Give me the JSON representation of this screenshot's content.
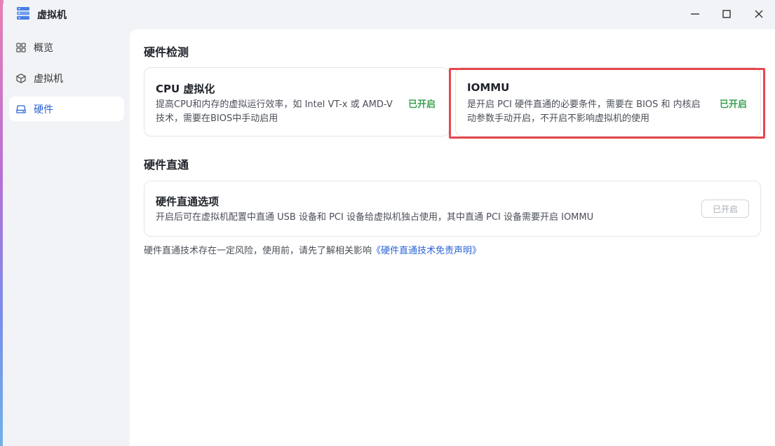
{
  "window": {
    "title": "虚拟机",
    "app_icon": "server-stack-icon",
    "controls": {
      "minimize": "minimize-icon",
      "maximize": "maximize-icon",
      "close": "close-icon"
    }
  },
  "sidebar": {
    "items": [
      {
        "label": "概览",
        "icon": "grid-icon",
        "active": false
      },
      {
        "label": "虚拟机",
        "icon": "cube-icon",
        "active": false
      },
      {
        "label": "硬件",
        "icon": "drive-icon",
        "active": true
      }
    ]
  },
  "main": {
    "detection": {
      "section_title": "硬件检测",
      "cpu": {
        "title": "CPU 虚拟化",
        "desc_line1": "提高CPU和内存的虚拟运行效率，如 Intel VT-x 或 AMD-V",
        "desc_line2": "技术，需要在BIOS中手动启用",
        "status": "已开启"
      },
      "iommu": {
        "title": "IOMMU",
        "desc_line1": "是开启 PCI 硬件直通的必要条件，需要在 BIOS 和 内核启",
        "desc_line2": "动参数手动开启，不开启不影响虚拟机的使用",
        "status": "已开启"
      }
    },
    "passthrough": {
      "section_title": "硬件直通",
      "option": {
        "title": "硬件直通选项",
        "desc": "开启后可在虚拟机配置中直通 USB 设备和 PCI 设备给虚拟机独占使用，其中直通 PCI 设备需要开启 IOMMU",
        "button": "已开启"
      },
      "note_text": "硬件直通技术存在一定风险，使用前，请先了解相关影响",
      "note_link": "《硬件直通技术免责声明》"
    }
  },
  "colors": {
    "accent": "#2a63d6",
    "status_green": "#3ba252",
    "highlight_red": "#e5484d"
  }
}
